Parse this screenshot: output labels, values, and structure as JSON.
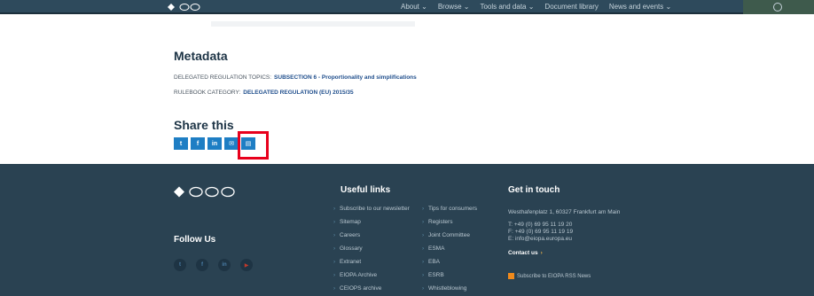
{
  "topnav": {
    "menu": [
      "About ⌄",
      "Browse ⌄",
      "Tools and data ⌄",
      "Document library",
      "News and events ⌄"
    ]
  },
  "metadata": {
    "title": "Metadata",
    "rows": [
      {
        "label": "DELEGATED REGULATION TOPICS:",
        "value": "SUBSECTION 6 - Proportionality and simplifications"
      },
      {
        "label": "RULEBOOK CATEGORY:",
        "value": "DELEGATED REGULATION (EU) 2015/35"
      }
    ]
  },
  "share": {
    "title": "Share this",
    "buttons": [
      {
        "name": "twitter-share-button",
        "glyph": "t"
      },
      {
        "name": "facebook-share-button",
        "glyph": "f"
      },
      {
        "name": "linkedin-share-button",
        "glyph": "in"
      },
      {
        "name": "email-share-button",
        "glyph": "✉"
      },
      {
        "name": "print-share-button",
        "glyph": "▤"
      }
    ]
  },
  "footer": {
    "useful_links_title": "Useful links",
    "get_in_touch_title": "Get in touch",
    "follow_us_title": "Follow Us",
    "links_col1": [
      "Subscribe to our newsletter",
      "Sitemap",
      "Careers",
      "Glossary",
      "Extranet",
      "EIOPA Archive",
      "CEIOPS archive"
    ],
    "links_col2": [
      "Tips for consumers",
      "Registers",
      "Joint Committee",
      "ESMA",
      "EBA",
      "ESRB",
      "Whistleblowing"
    ],
    "address": "Westhafenplatz 1, 60327 Frankfurt am Main",
    "phone": "T: +49 (0) 69 95 11 19 20",
    "fax": "F: +49 (0) 69 95 11 19 19",
    "email": "E: info@eiopa.europa.eu",
    "contact_label": "Contact us",
    "rss_label": "Subscribe to EIOPA RSS News",
    "social": [
      "t",
      "f",
      "in",
      "▶"
    ]
  }
}
